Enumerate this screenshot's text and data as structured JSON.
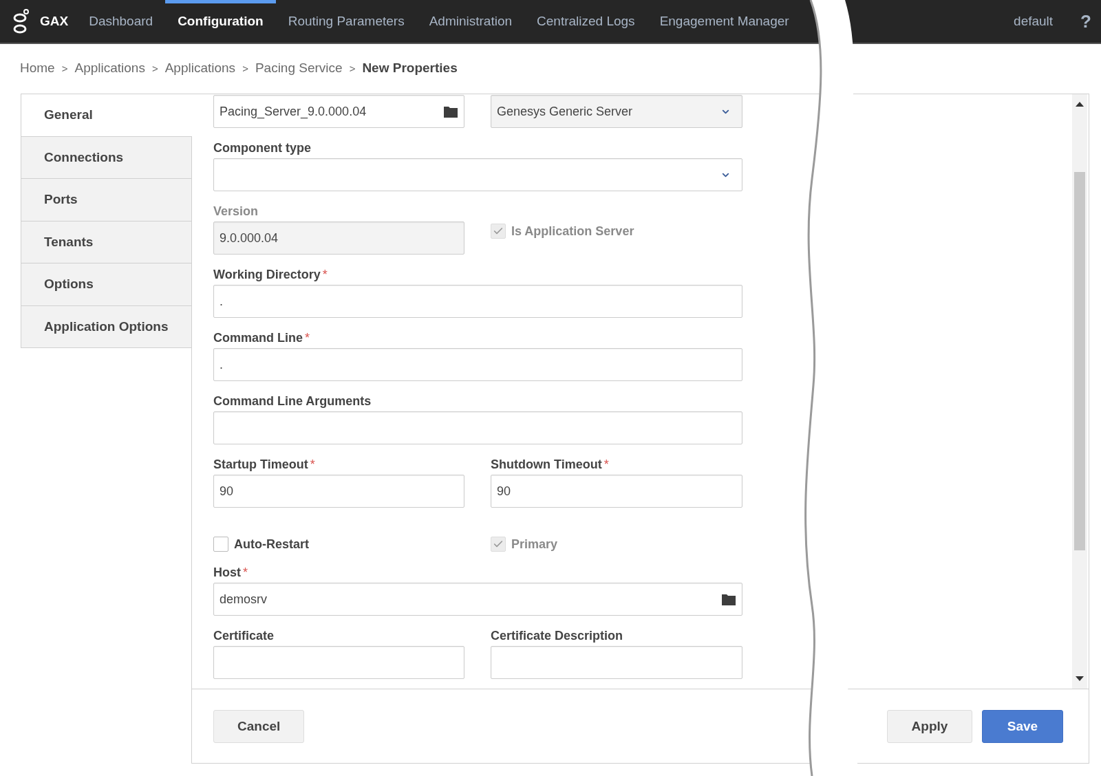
{
  "nav": {
    "brand": "GAX",
    "items": [
      {
        "label": "Dashboard",
        "selected": false
      },
      {
        "label": "Configuration",
        "selected": true
      },
      {
        "label": "Routing Parameters",
        "selected": false
      },
      {
        "label": "Administration",
        "selected": false
      },
      {
        "label": "Centralized Logs",
        "selected": false
      },
      {
        "label": "Engagement Manager",
        "selected": false
      }
    ],
    "user": "default",
    "help": "?"
  },
  "breadcrumb": [
    {
      "label": "Home",
      "current": false,
      "separator": ">"
    },
    {
      "label": "Applications",
      "current": false,
      "separator": ">"
    },
    {
      "label": "Applications",
      "current": false,
      "separator": ">"
    },
    {
      "label": "Pacing Service",
      "current": false,
      "separator": ">"
    },
    {
      "label": "New Properties",
      "current": true
    }
  ],
  "sidebar": [
    {
      "label": "General",
      "selected": true
    },
    {
      "label": "Connections",
      "selected": false
    },
    {
      "label": "Ports",
      "selected": false
    },
    {
      "label": "Tenants",
      "selected": false
    },
    {
      "label": "Options",
      "selected": false
    },
    {
      "label": "Application Options",
      "selected": false
    }
  ],
  "form": {
    "rows": [
      {
        "fields": [
          {
            "kind": "picker",
            "value": "Pacing_Server_9.0.000.04",
            "disabled": false
          },
          {
            "kind": "select",
            "value": "Genesys Generic Server",
            "disabled": true
          }
        ]
      },
      {
        "fields": [
          {
            "kind": "select",
            "label": "Component type",
            "disabled": false
          }
        ]
      },
      {
        "fields": [
          {
            "kind": "text",
            "label": "Version",
            "value": "9.0.000.04",
            "disabled": true
          },
          {
            "kind": "checkbox",
            "label": "Is Application Server",
            "checked": true,
            "disabled": true
          }
        ]
      },
      {
        "fields": [
          {
            "kind": "text",
            "label": "Working Directory",
            "required_mark": "*",
            "value": ".",
            "disabled": false
          }
        ]
      },
      {
        "fields": [
          {
            "kind": "text",
            "label": "Command Line",
            "required_mark": "*",
            "value": ".",
            "disabled": false
          }
        ]
      },
      {
        "fields": [
          {
            "kind": "text",
            "label": "Command Line Arguments",
            "disabled": false
          }
        ]
      },
      {
        "fields": [
          {
            "kind": "text",
            "label": "Startup Timeout",
            "required_mark": "*",
            "value": "90",
            "disabled": false
          },
          {
            "kind": "text",
            "label": "Shutdown Timeout",
            "required_mark": "*",
            "value": "90",
            "disabled": false
          }
        ]
      },
      {
        "fields": [
          {
            "kind": "checkbox",
            "label": "Auto-Restart",
            "checked": false,
            "disabled": false
          },
          {
            "kind": "checkbox",
            "label": "Primary",
            "checked": true,
            "disabled": true
          }
        ]
      },
      {
        "fields": [
          {
            "kind": "picker",
            "label": "Host",
            "required_mark": "*",
            "value": "demosrv",
            "disabled": false
          }
        ]
      },
      {
        "fields": [
          {
            "kind": "text",
            "label": "Certificate",
            "disabled": false
          },
          {
            "kind": "text",
            "label": "Certificate Description",
            "disabled": false
          }
        ]
      }
    ]
  },
  "footer": {
    "buttons": [
      {
        "label": "Cancel",
        "kind": "secondary"
      },
      {
        "label": "Apply",
        "kind": "secondary"
      },
      {
        "label": "Save",
        "kind": "primary"
      }
    ]
  }
}
